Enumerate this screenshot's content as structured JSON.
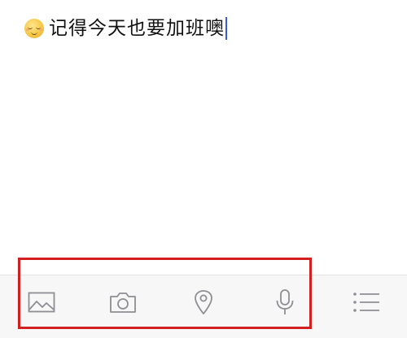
{
  "note": {
    "emoji": "relieved-face-emoji",
    "text": "记得今天也要加班噢",
    "caret_color": "#3b5ad6"
  },
  "toolbar": {
    "highlight_color": "#d21f1f",
    "buttons": [
      {
        "icon": "image-icon"
      },
      {
        "icon": "camera-icon"
      },
      {
        "icon": "location-pin-icon"
      },
      {
        "icon": "microphone-icon"
      },
      {
        "icon": "list-icon"
      }
    ]
  }
}
